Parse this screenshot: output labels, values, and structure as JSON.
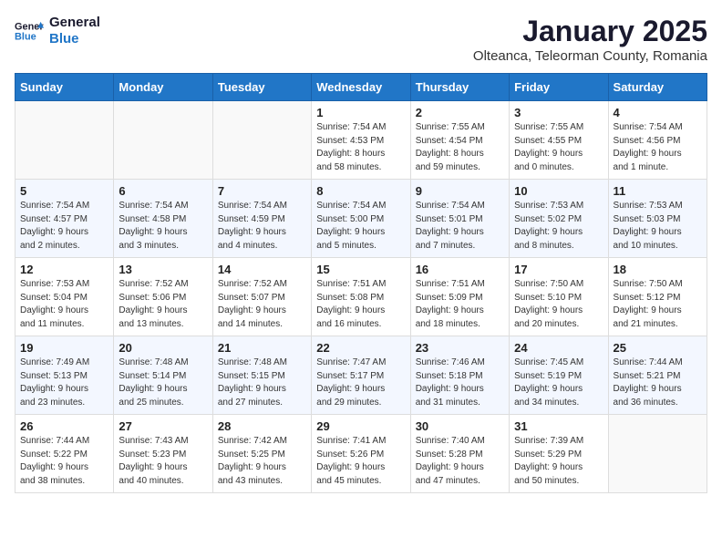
{
  "header": {
    "logo_line1": "General",
    "logo_line2": "Blue",
    "month": "January 2025",
    "location": "Olteanca, Teleorman County, Romania"
  },
  "weekdays": [
    "Sunday",
    "Monday",
    "Tuesday",
    "Wednesday",
    "Thursday",
    "Friday",
    "Saturday"
  ],
  "weeks": [
    [
      {
        "day": "",
        "info": ""
      },
      {
        "day": "",
        "info": ""
      },
      {
        "day": "",
        "info": ""
      },
      {
        "day": "1",
        "info": "Sunrise: 7:54 AM\nSunset: 4:53 PM\nDaylight: 8 hours\nand 58 minutes."
      },
      {
        "day": "2",
        "info": "Sunrise: 7:55 AM\nSunset: 4:54 PM\nDaylight: 8 hours\nand 59 minutes."
      },
      {
        "day": "3",
        "info": "Sunrise: 7:55 AM\nSunset: 4:55 PM\nDaylight: 9 hours\nand 0 minutes."
      },
      {
        "day": "4",
        "info": "Sunrise: 7:54 AM\nSunset: 4:56 PM\nDaylight: 9 hours\nand 1 minute."
      }
    ],
    [
      {
        "day": "5",
        "info": "Sunrise: 7:54 AM\nSunset: 4:57 PM\nDaylight: 9 hours\nand 2 minutes."
      },
      {
        "day": "6",
        "info": "Sunrise: 7:54 AM\nSunset: 4:58 PM\nDaylight: 9 hours\nand 3 minutes."
      },
      {
        "day": "7",
        "info": "Sunrise: 7:54 AM\nSunset: 4:59 PM\nDaylight: 9 hours\nand 4 minutes."
      },
      {
        "day": "8",
        "info": "Sunrise: 7:54 AM\nSunset: 5:00 PM\nDaylight: 9 hours\nand 5 minutes."
      },
      {
        "day": "9",
        "info": "Sunrise: 7:54 AM\nSunset: 5:01 PM\nDaylight: 9 hours\nand 7 minutes."
      },
      {
        "day": "10",
        "info": "Sunrise: 7:53 AM\nSunset: 5:02 PM\nDaylight: 9 hours\nand 8 minutes."
      },
      {
        "day": "11",
        "info": "Sunrise: 7:53 AM\nSunset: 5:03 PM\nDaylight: 9 hours\nand 10 minutes."
      }
    ],
    [
      {
        "day": "12",
        "info": "Sunrise: 7:53 AM\nSunset: 5:04 PM\nDaylight: 9 hours\nand 11 minutes."
      },
      {
        "day": "13",
        "info": "Sunrise: 7:52 AM\nSunset: 5:06 PM\nDaylight: 9 hours\nand 13 minutes."
      },
      {
        "day": "14",
        "info": "Sunrise: 7:52 AM\nSunset: 5:07 PM\nDaylight: 9 hours\nand 14 minutes."
      },
      {
        "day": "15",
        "info": "Sunrise: 7:51 AM\nSunset: 5:08 PM\nDaylight: 9 hours\nand 16 minutes."
      },
      {
        "day": "16",
        "info": "Sunrise: 7:51 AM\nSunset: 5:09 PM\nDaylight: 9 hours\nand 18 minutes."
      },
      {
        "day": "17",
        "info": "Sunrise: 7:50 AM\nSunset: 5:10 PM\nDaylight: 9 hours\nand 20 minutes."
      },
      {
        "day": "18",
        "info": "Sunrise: 7:50 AM\nSunset: 5:12 PM\nDaylight: 9 hours\nand 21 minutes."
      }
    ],
    [
      {
        "day": "19",
        "info": "Sunrise: 7:49 AM\nSunset: 5:13 PM\nDaylight: 9 hours\nand 23 minutes."
      },
      {
        "day": "20",
        "info": "Sunrise: 7:48 AM\nSunset: 5:14 PM\nDaylight: 9 hours\nand 25 minutes."
      },
      {
        "day": "21",
        "info": "Sunrise: 7:48 AM\nSunset: 5:15 PM\nDaylight: 9 hours\nand 27 minutes."
      },
      {
        "day": "22",
        "info": "Sunrise: 7:47 AM\nSunset: 5:17 PM\nDaylight: 9 hours\nand 29 minutes."
      },
      {
        "day": "23",
        "info": "Sunrise: 7:46 AM\nSunset: 5:18 PM\nDaylight: 9 hours\nand 31 minutes."
      },
      {
        "day": "24",
        "info": "Sunrise: 7:45 AM\nSunset: 5:19 PM\nDaylight: 9 hours\nand 34 minutes."
      },
      {
        "day": "25",
        "info": "Sunrise: 7:44 AM\nSunset: 5:21 PM\nDaylight: 9 hours\nand 36 minutes."
      }
    ],
    [
      {
        "day": "26",
        "info": "Sunrise: 7:44 AM\nSunset: 5:22 PM\nDaylight: 9 hours\nand 38 minutes."
      },
      {
        "day": "27",
        "info": "Sunrise: 7:43 AM\nSunset: 5:23 PM\nDaylight: 9 hours\nand 40 minutes."
      },
      {
        "day": "28",
        "info": "Sunrise: 7:42 AM\nSunset: 5:25 PM\nDaylight: 9 hours\nand 43 minutes."
      },
      {
        "day": "29",
        "info": "Sunrise: 7:41 AM\nSunset: 5:26 PM\nDaylight: 9 hours\nand 45 minutes."
      },
      {
        "day": "30",
        "info": "Sunrise: 7:40 AM\nSunset: 5:28 PM\nDaylight: 9 hours\nand 47 minutes."
      },
      {
        "day": "31",
        "info": "Sunrise: 7:39 AM\nSunset: 5:29 PM\nDaylight: 9 hours\nand 50 minutes."
      },
      {
        "day": "",
        "info": ""
      }
    ]
  ]
}
